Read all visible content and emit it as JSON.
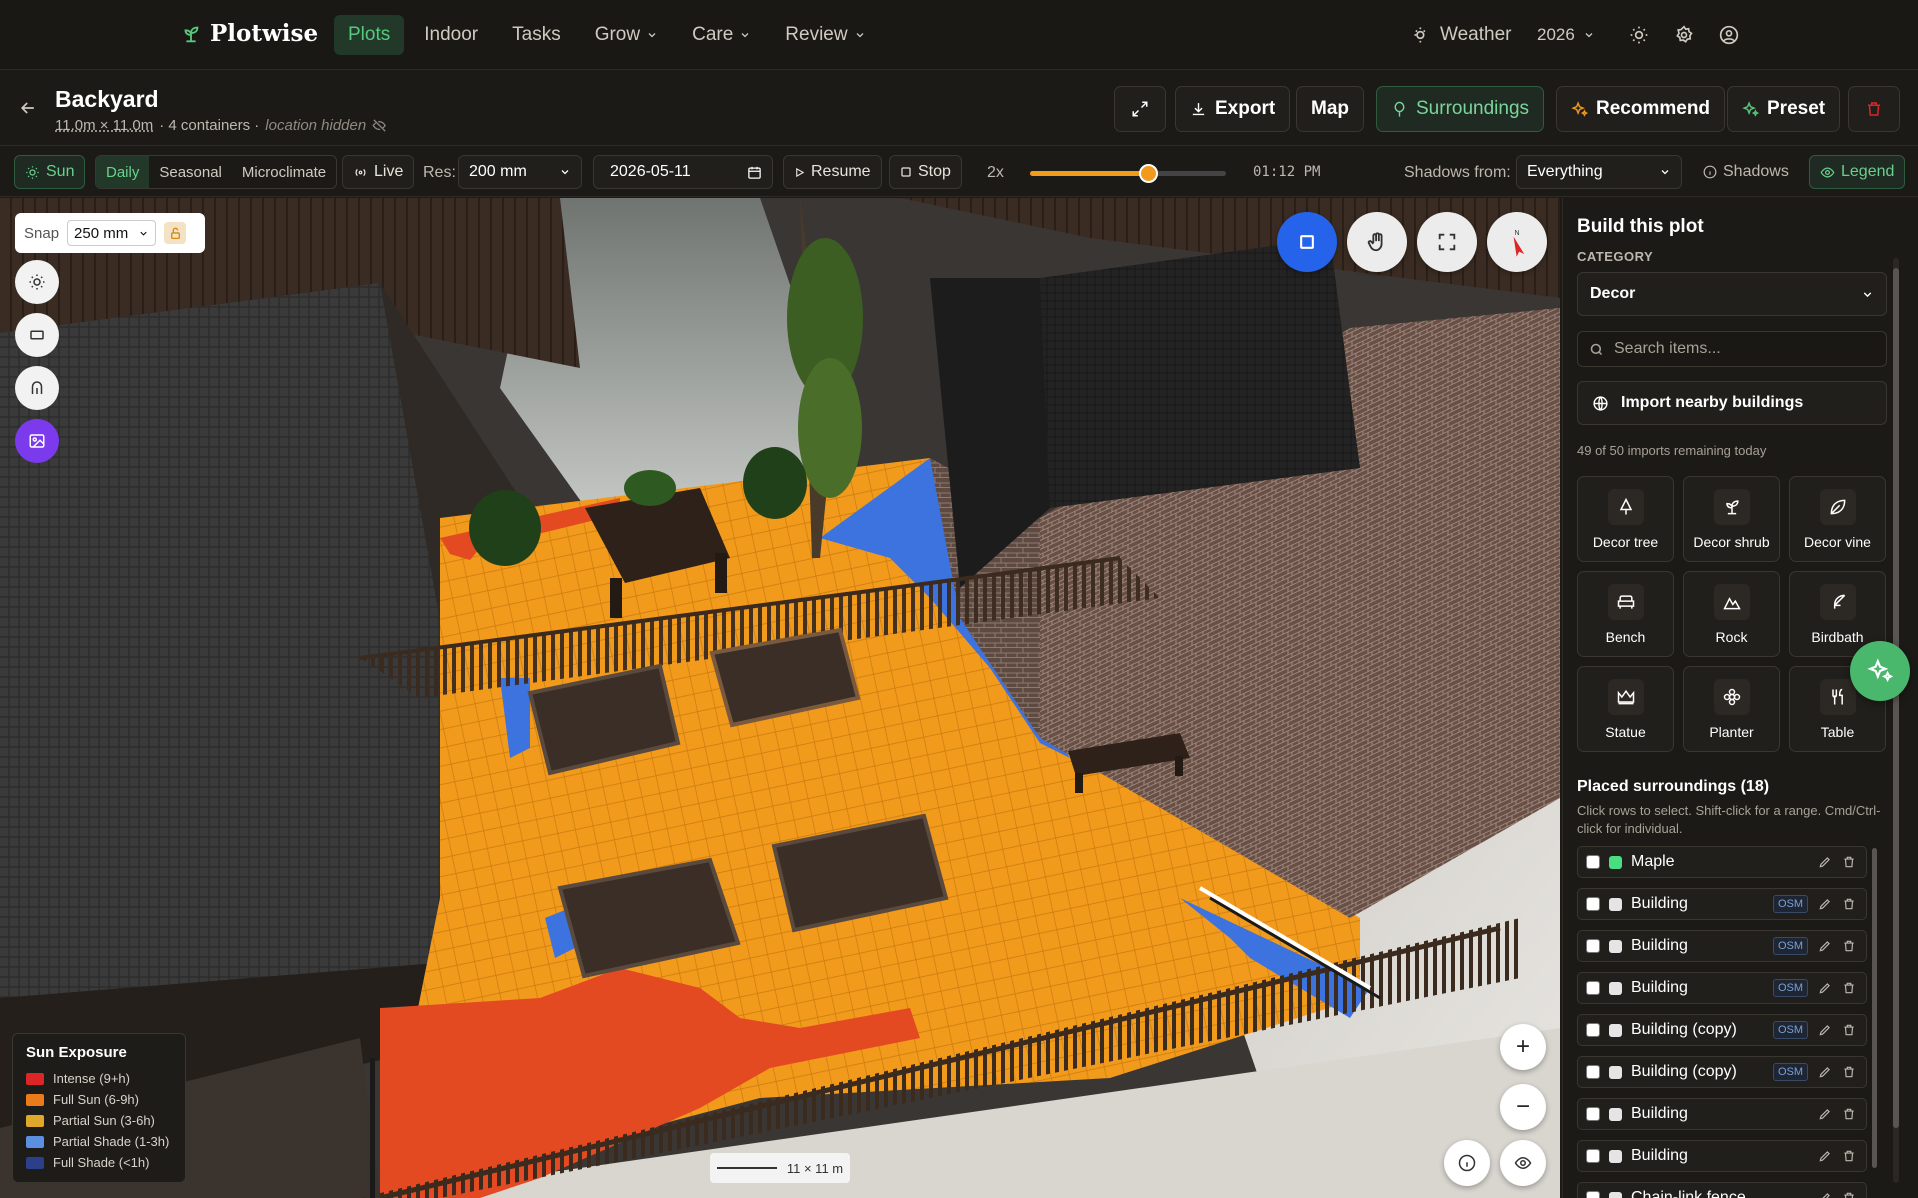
{
  "app": {
    "brand": "Plotwise"
  },
  "nav": {
    "items": [
      {
        "label": "Plots"
      },
      {
        "label": "Indoor"
      },
      {
        "label": "Tasks"
      },
      {
        "label": "Grow"
      },
      {
        "label": "Care"
      },
      {
        "label": "Review"
      }
    ],
    "weather_label": "Weather",
    "year": "2026"
  },
  "plot": {
    "title": "Backyard",
    "dimensions": "11.0m × 11.0m",
    "containers": "· 4 containers ·",
    "location": "location hidden"
  },
  "actions": {
    "export": "Export",
    "map": "Map",
    "surroundings": "Surroundings",
    "recommend": "Recommend",
    "preset": "Preset"
  },
  "controls": {
    "sun": "Sun",
    "modes": [
      "Daily",
      "Seasonal",
      "Microclimate"
    ],
    "live": "Live",
    "res_label": "Res:",
    "res_value": "200 mm",
    "date": "2026-05-11",
    "resume": "Resume",
    "stop": "Stop",
    "speed": "2x",
    "time": "01:12 PM",
    "time_progress": 0.6,
    "shadows_from_label": "Shadows from:",
    "shadows_from_value": "Everything",
    "shadows": "Shadows",
    "legend": "Legend"
  },
  "viewport": {
    "snap_label": "Snap",
    "snap_value": "250 mm",
    "scale": "11 × 11 m",
    "legend_title": "Sun Exposure",
    "legend_items": [
      {
        "label": "Intense (9+h)",
        "color": "#dc2626"
      },
      {
        "label": "Full Sun (6-9h)",
        "color": "#ea7a1a"
      },
      {
        "label": "Partial Sun (3-6h)",
        "color": "#e0a82a"
      },
      {
        "label": "Partial Shade (1-3h)",
        "color": "#5b8fe0"
      },
      {
        "label": "Full Shade (<1h)",
        "color": "#2c3f8a"
      }
    ],
    "zoom_in": "+",
    "zoom_out": "−"
  },
  "panel": {
    "title": "Build this plot",
    "category_label": "CATEGORY",
    "category_value": "Decor",
    "search_placeholder": "Search items...",
    "import_label": "Import nearby buildings",
    "remaining": "49 of 50 imports remaining today",
    "items": [
      {
        "label": "Decor tree",
        "icon": "tree-icon"
      },
      {
        "label": "Decor shrub",
        "icon": "sprout-icon"
      },
      {
        "label": "Decor vine",
        "icon": "leaf-icon"
      },
      {
        "label": "Bench",
        "icon": "armchair-icon"
      },
      {
        "label": "Rock",
        "icon": "mountain-icon"
      },
      {
        "label": "Birdbath",
        "icon": "feather-icon"
      },
      {
        "label": "Statue",
        "icon": "crown-icon"
      },
      {
        "label": "Planter",
        "icon": "flower-icon"
      },
      {
        "label": "Table",
        "icon": "utensils-icon"
      }
    ],
    "placed_title": "Placed surroundings (18)",
    "placed_help": "Click rows to select. Shift-click for a range. Cmd/Ctrl-click for individual.",
    "osm_badge": "OSM",
    "rows": [
      {
        "label": "Maple",
        "color": "#4ade80",
        "osm": false
      },
      {
        "label": "Building",
        "color": "#e5e5e5",
        "osm": true
      },
      {
        "label": "Building",
        "color": "#e5e5e5",
        "osm": true
      },
      {
        "label": "Building",
        "color": "#e5e5e5",
        "osm": true
      },
      {
        "label": "Building (copy)",
        "color": "#e5e5e5",
        "osm": true
      },
      {
        "label": "Building (copy)",
        "color": "#e5e5e5",
        "osm": true
      },
      {
        "label": "Building",
        "color": "#e5e5e5",
        "osm": false
      },
      {
        "label": "Building",
        "color": "#e5e5e5",
        "osm": false
      },
      {
        "label": "Chain-link fence",
        "color": "#e5e5e5",
        "osm": false
      }
    ]
  },
  "colors": {
    "accent_green": "#56c97c",
    "sun_orange": "#f29a1c",
    "tool_blue": "#2563eb",
    "tool_purple": "#7c3aed",
    "danger": "#dc2626"
  }
}
